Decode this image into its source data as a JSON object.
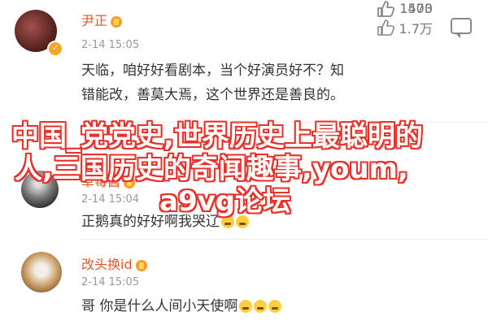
{
  "comments": [
    {
      "username": "尹正",
      "time": "2-14 15:05",
      "likes": "1.7万",
      "text_line1": "天临，咱好好看剧本，当个好演员好不？知",
      "text_line2": "错能改，善莫大焉，这个世界还是善良的。"
    },
    {
      "username": "草莓酱",
      "time": "2-14 15:04",
      "likes": "1503",
      "text": "正鹅真的好好啊我哭辽"
    },
    {
      "username": "改头换id",
      "time": "2-14 15:05",
      "likes": "1470",
      "text": "哥 你是什么人间小天使啊"
    }
  ],
  "overlay": {
    "line1": "中国_党党史,世界历史上最聪明的",
    "line2": "人,三国历史的奇闻趣事,youm,",
    "line3": "a9vg论坛"
  },
  "colors": {
    "username": "#e0582b",
    "overlay_stroke": "#e7322b",
    "meta_text": "#999999"
  }
}
